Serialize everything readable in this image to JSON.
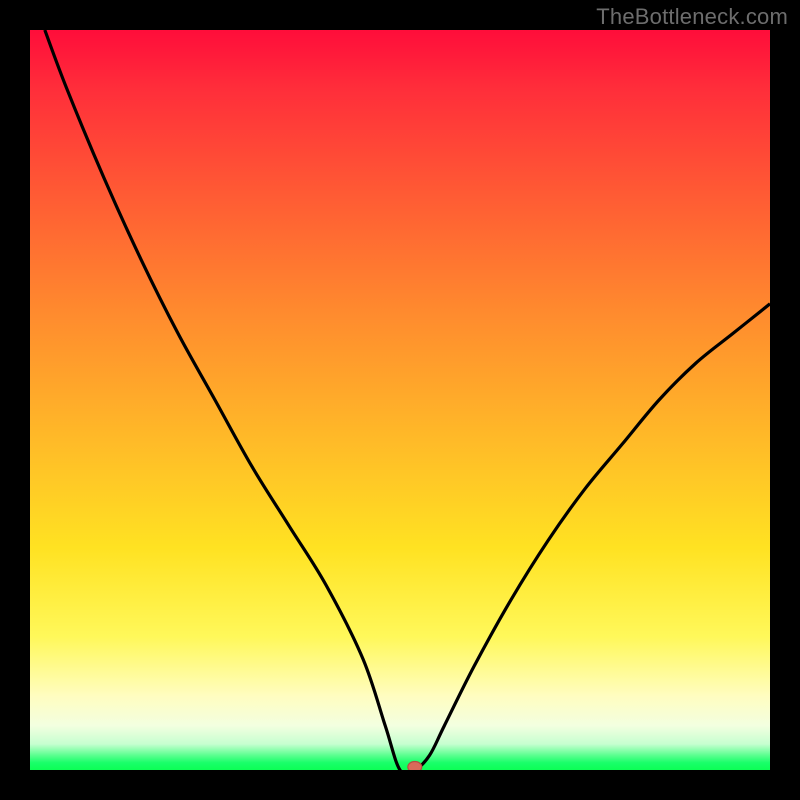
{
  "watermark": "TheBottleneck.com",
  "chart_data": {
    "type": "line",
    "title": "",
    "xlabel": "",
    "ylabel": "",
    "xlim": [
      0,
      100
    ],
    "ylim": [
      0,
      100
    ],
    "series": [
      {
        "name": "bottleneck-curve",
        "x": [
          2,
          5,
          10,
          15,
          20,
          25,
          30,
          35,
          40,
          45,
          48,
          50,
          52,
          54,
          56,
          60,
          65,
          70,
          75,
          80,
          85,
          90,
          95,
          100
        ],
        "values": [
          100,
          92,
          80,
          69,
          59,
          50,
          41,
          33,
          25,
          15,
          6,
          0,
          0,
          2,
          6,
          14,
          23,
          31,
          38,
          44,
          50,
          55,
          59,
          63
        ]
      }
    ],
    "marker": {
      "x": 52,
      "y": 0,
      "color": "#d96a5a"
    },
    "background_gradient": {
      "top": "#ff0d3a",
      "middle": "#ffe222",
      "bottom": "#0cff55"
    }
  }
}
